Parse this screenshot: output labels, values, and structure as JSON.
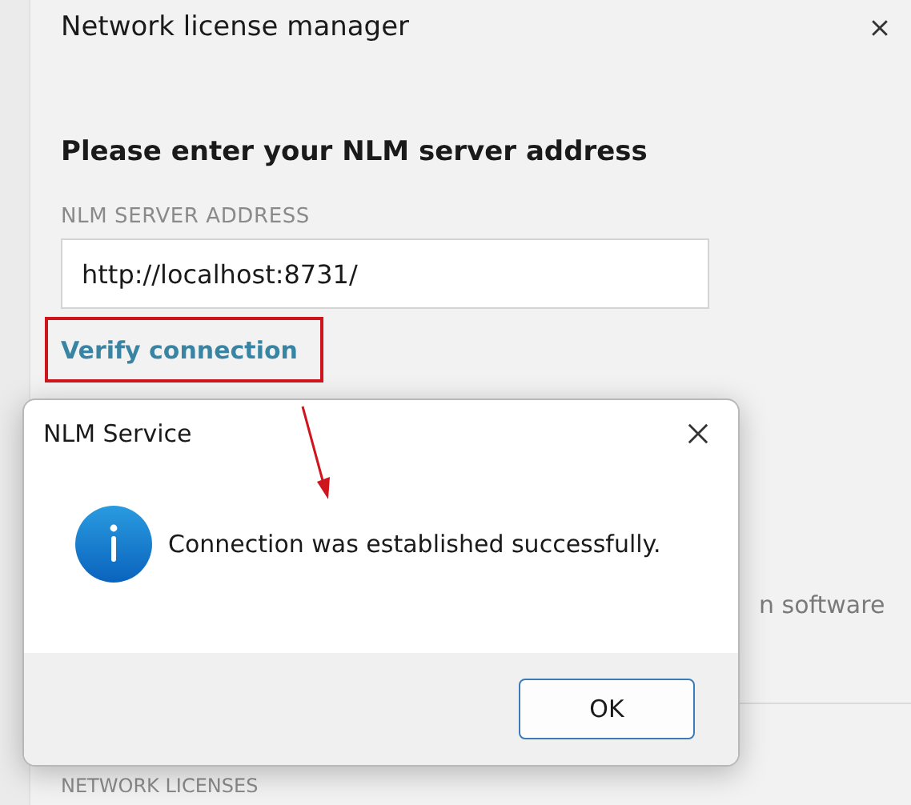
{
  "window": {
    "title": "Network license manager"
  },
  "heading": "Please enter your NLM server address",
  "server_field": {
    "label": "NLM SERVER ADDRESS",
    "value": "http://localhost:8731/"
  },
  "verify_link": "Verify connection",
  "description_fragment": "n software",
  "section_label": "NETWORK LICENSES",
  "dialog": {
    "title": "NLM Service",
    "message": "Connection was established successfully.",
    "buttons": [
      "OK"
    ]
  }
}
